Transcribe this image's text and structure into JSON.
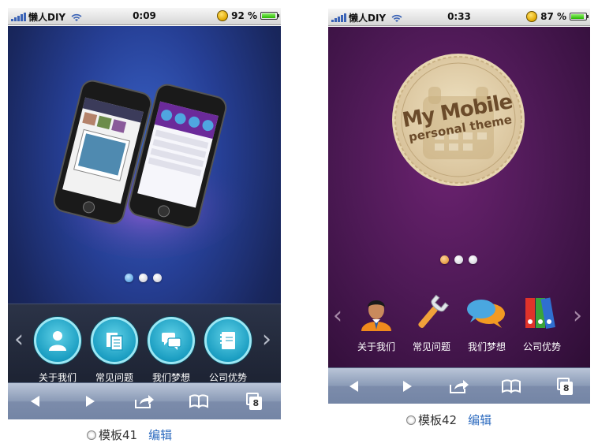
{
  "themes": [
    {
      "status": {
        "carrier": "懒人DIY",
        "time": "0:09",
        "battery": "92 %",
        "battery_level": 0.92
      },
      "banner": {
        "dots": 3,
        "active_dot": 0,
        "dot_color": "#3b8fd9"
      },
      "menu": [
        {
          "label": "关于我们",
          "icon": "person-icon"
        },
        {
          "label": "常见问题",
          "icon": "documents-icon"
        },
        {
          "label": "我们梦想",
          "icon": "chat-bubbles-icon"
        },
        {
          "label": "公司优势",
          "icon": "notebook-icon"
        }
      ],
      "tabs_count": "8",
      "caption": {
        "name": "模板41",
        "edit": "编辑"
      }
    },
    {
      "status": {
        "carrier": "懒人DIY",
        "time": "0:33",
        "battery": "87 %",
        "battery_level": 0.87
      },
      "banner": {
        "logo_line1": "My Mobile",
        "logo_line2": "personal theme",
        "dots": 3,
        "active_dot": 0,
        "dot_color": "#d9861f"
      },
      "menu": [
        {
          "label": "关于我们",
          "icon": "businessman-icon"
        },
        {
          "label": "常见问题",
          "icon": "wrench-icon"
        },
        {
          "label": "我们梦想",
          "icon": "speech-bubbles-icon"
        },
        {
          "label": "公司优势",
          "icon": "binders-icon"
        }
      ],
      "tabs_count": "8",
      "caption": {
        "name": "模板42",
        "edit": "编辑"
      }
    }
  ]
}
